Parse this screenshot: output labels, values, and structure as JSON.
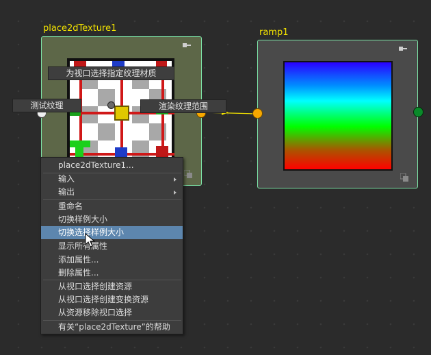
{
  "nodes": {
    "place2d": {
      "title": "place2dTexture1",
      "colors": {
        "border": "#7ee6a8",
        "body": "#5d6748",
        "title": "#f2e200"
      }
    },
    "ramp": {
      "title": "ramp1",
      "colors": {
        "border": "#7ee6a8",
        "body": "#4a4a4a",
        "gradient": [
          "#2a00ff",
          "#00ffff",
          "#00ff00",
          "#ff0000"
        ]
      }
    }
  },
  "tags": {
    "assign_texture": "为视口选择指定纹理材质",
    "test_texture": "测试纹理",
    "render_range": "渲染纹理范围"
  },
  "context_menu": {
    "header": "place2dTexture1...",
    "input": "输入",
    "output": "输出",
    "rename": "重命名",
    "toggle_swatch_size": "切换样例大小",
    "toggle_selected_swatch_size": "切换选择样例大小",
    "show_all_attrs": "显示所有属性",
    "add_attr": "添加属性...",
    "delete_attr": "删除属性...",
    "create_asset": "从视口选择创建资源",
    "create_transform_asset": "从视口选择创建变换资源",
    "remove_from_asset": "从资源移除视口选择",
    "help": "有关“place2dTexture”的帮助",
    "highlight_color": "#5d86ae"
  },
  "icons": {
    "pin": "pin-icon",
    "swatch_toggle": "swatch-toggle-icon",
    "cursor": "mouse-cursor-icon",
    "arrow": "connection-arrow-icon"
  },
  "port_colors": {
    "output_yellow": "#f7a800",
    "input_yellow": "#f7a800",
    "ramp_output_green": "#0a8a2a",
    "test_white": "#f0f0f0"
  }
}
